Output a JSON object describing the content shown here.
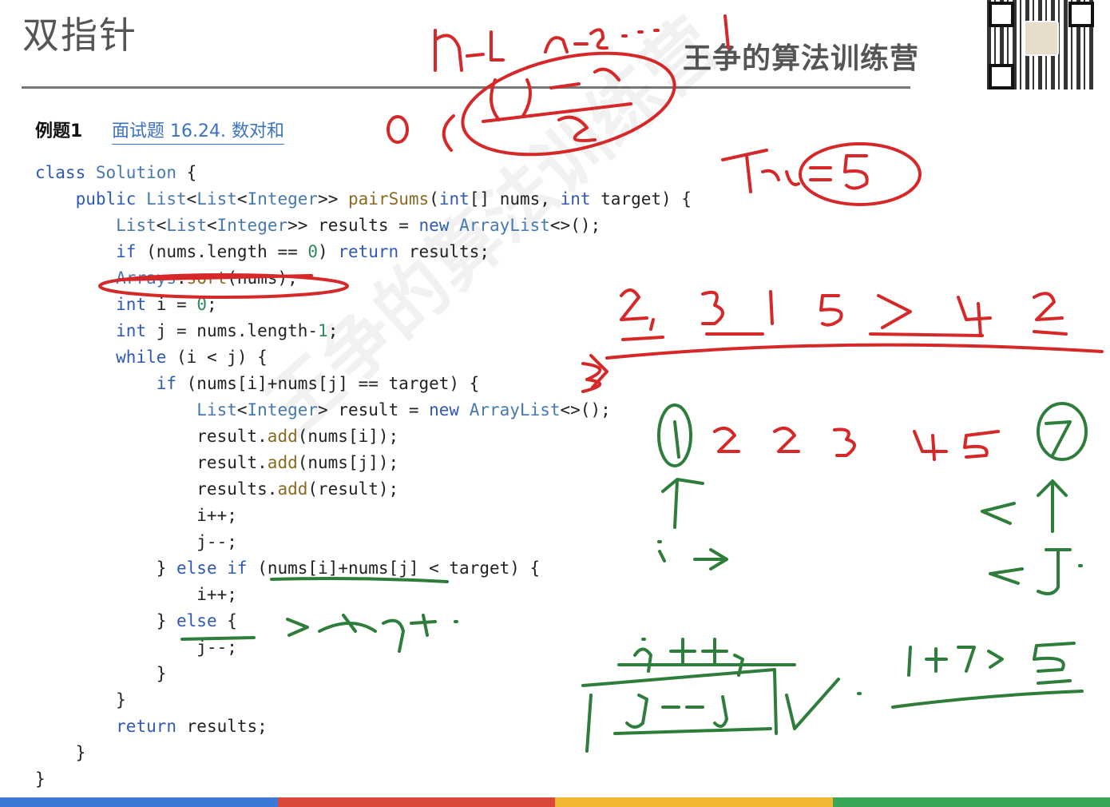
{
  "slide": {
    "title": "双指针",
    "brand": "王争的算法训练营",
    "qr_label": "qr-code"
  },
  "example": {
    "label": "例题1",
    "link": "面试题 16.24. 数对和"
  },
  "code_lines": [
    "class Solution {",
    "    public List<List<Integer>> pairSums(int[] nums, int target) {",
    "        List<List<Integer>> results = new ArrayList<>();",
    "        if (nums.length == 0) return results;",
    "        Arrays.sort(nums);",
    "        int i = 0;",
    "        int j = nums.length-1;",
    "        while (i < j) {",
    "            if (nums[i]+nums[j] == target) {",
    "                List<Integer> result = new ArrayList<>();",
    "                result.add(nums[i]);",
    "                result.add(nums[j]);",
    "                results.add(result);",
    "                i++;",
    "                j--;",
    "            } else if (nums[i]+nums[j] < target) {",
    "                i++;",
    "            } else {",
    "                j--;",
    "            }",
    "        }",
    "        return results;",
    "    }",
    "}"
  ],
  "watermark": "王争的算法训练营",
  "handwriting": {
    "red_top": [
      "n-1",
      "n-2",
      "...",
      "1",
      "(n-1)n",
      "2",
      "O(",
      "target=5"
    ],
    "red_array": [
      "2",
      "3",
      "1",
      "5",
      "7",
      "4",
      "2"
    ],
    "green_sorted": [
      "1",
      "2",
      "2",
      "3",
      "4",
      "5",
      "7"
    ],
    "green_pointers": [
      "i",
      "j"
    ],
    "green_notes": [
      ">target",
      "i++",
      "j--",
      "1+7>5"
    ]
  },
  "colors": {
    "title_gray": "#555555",
    "link_blue": "#3b72c4",
    "keyword_blue": "#2f59b8",
    "ink_red": "#d62828",
    "ink_green": "#2e7d3a",
    "bar": [
      "#3b78d8",
      "#d9483b",
      "#f2b731",
      "#3aa757"
    ]
  }
}
